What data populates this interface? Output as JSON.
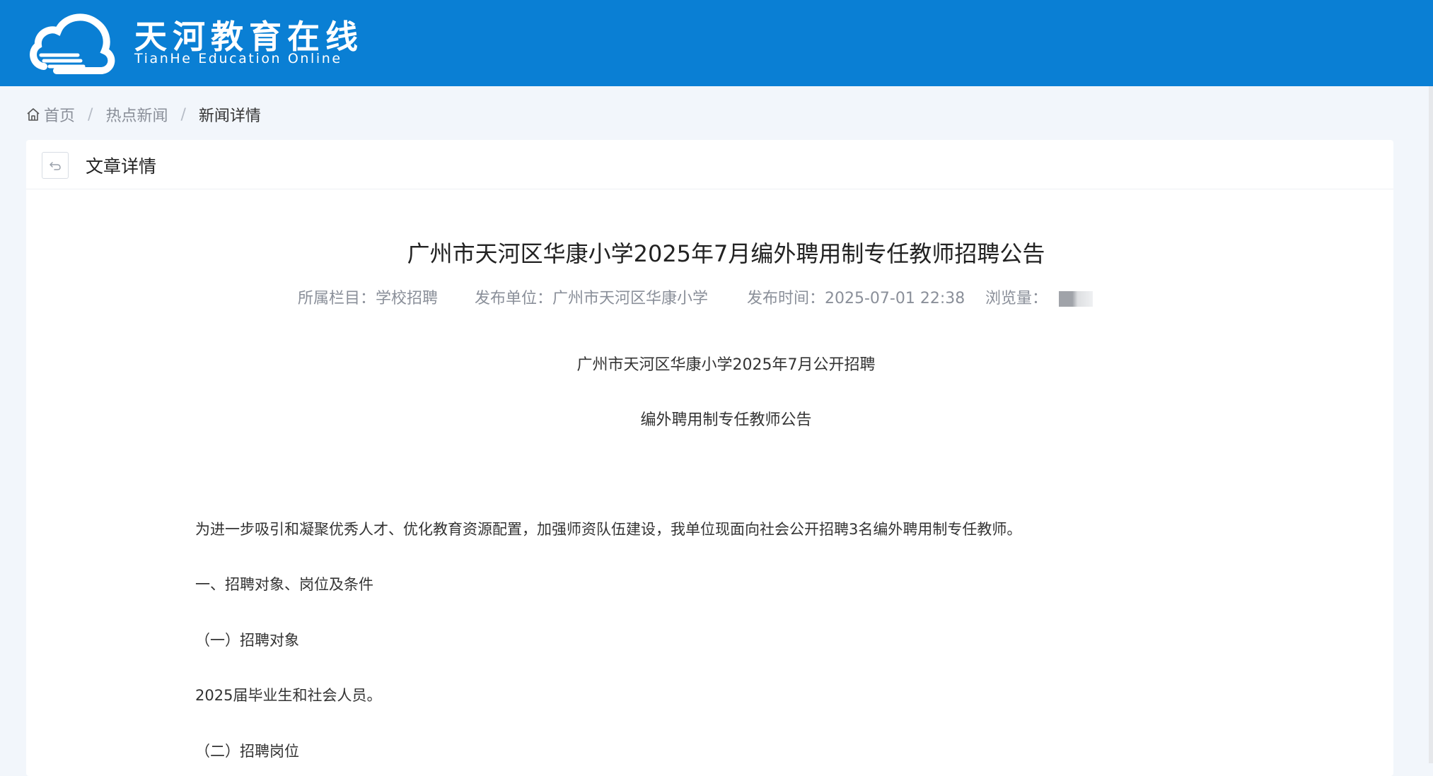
{
  "site": {
    "title": "天河教育在线",
    "subtitle": "TianHe Education Online"
  },
  "breadcrumb": {
    "home": "首页",
    "level2": "热点新闻",
    "current": "新闻详情",
    "separator": "/"
  },
  "card": {
    "title": "文章详情"
  },
  "article": {
    "title": "广州市天河区华康小学2025年7月编外聘用制专任教师招聘公告",
    "meta": {
      "column": "所属栏目：学校招聘",
      "publisher": "发布单位：广州市天河区华康小学",
      "publish_time": "发布时间：2025-07-01 22:38",
      "views_label": "浏览量："
    },
    "subtitle_line1": "广州市天河区华康小学2025年7月公开招聘",
    "subtitle_line2": "编外聘用制专任教师公告",
    "paragraphs": [
      "为进一步吸引和凝聚优秀人才、优化教育资源配置，加强师资队伍建设，我单位现面向社会公开招聘3名编外聘用制专任教师。",
      "一、招聘对象、岗位及条件",
      "（一）招聘对象",
      "2025届毕业生和社会人员。",
      "（二）招聘岗位"
    ]
  },
  "colors": {
    "header_bg": "#0a7fd4",
    "page_bg": "#f2f6fb",
    "card_bg": "#ffffff"
  }
}
